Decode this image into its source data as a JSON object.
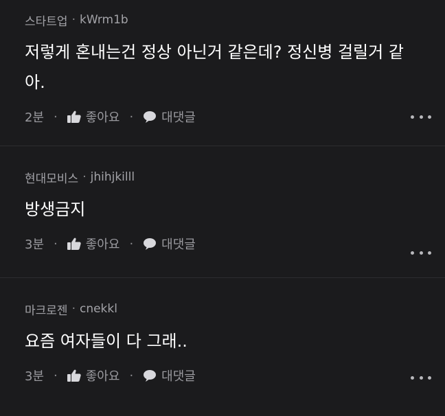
{
  "comments": [
    {
      "company": "스타트업",
      "nickname": "kWrm1b",
      "text_line1": "저렇게 혼내는건 정상 아닌거 같은데? 정신병 걸릴거 같",
      "text_line2": "아.",
      "time": "2분",
      "like_label": "좋아요",
      "reply_label": "대댓글"
    },
    {
      "company": "현대모비스",
      "nickname": "jhihjkilll",
      "text_line1": "방생금지",
      "time": "3분",
      "like_label": "좋아요",
      "reply_label": "대댓글"
    },
    {
      "company": "마크로젠",
      "nickname": "cnekkl",
      "text_line1": "요즘 여자들이 다 그래..",
      "time": "3분",
      "like_label": "좋아요",
      "reply_label": "대댓글"
    }
  ],
  "icons": {
    "like": "thumbs-up-icon",
    "reply": "speech-bubble-icon",
    "more": "more-dots-icon"
  }
}
